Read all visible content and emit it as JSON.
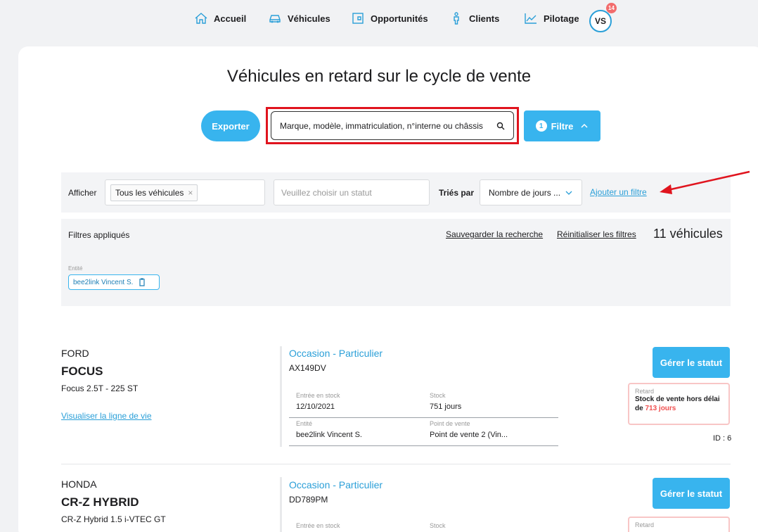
{
  "nav": {
    "items": [
      {
        "label": "Accueil",
        "icon": "home-icon"
      },
      {
        "label": "Véhicules",
        "icon": "car-icon"
      },
      {
        "label": "Opportunités",
        "icon": "wallet-icon"
      },
      {
        "label": "Clients",
        "icon": "person-icon"
      },
      {
        "label": "Pilotage",
        "icon": "chart-icon"
      }
    ],
    "avatar": "VS",
    "badge": "14"
  },
  "page": {
    "title": "Véhicules en retard sur le cycle de vente"
  },
  "toolbar": {
    "export_label": "Exporter",
    "search_placeholder": "Marque, modèle, immatriculation, n°interne ou châssis",
    "filter_count": "1",
    "filter_label": "Filtre"
  },
  "filters": {
    "show_label": "Afficher",
    "show_chip": "Tous les véhicules",
    "status_placeholder": "Veuillez choisir un statut",
    "sort_label": "Triés par",
    "sort_value": "Nombre de jours ...",
    "add_filter": "Ajouter un filtre"
  },
  "applied": {
    "title": "Filtres appliqués",
    "save_search": "Sauvegarder la recherche",
    "reset": "Réinitialiser les filtres",
    "count": "11 véhicules",
    "entity_label": "Entité",
    "entity_value": "bee2link Vincent S."
  },
  "vehicles": [
    {
      "brand": "FORD",
      "model": "FOCUS",
      "version": "Focus 2.5T - 225 ST",
      "lifeline": "Visualiser la ligne de vie",
      "type": "Occasion - Particulier",
      "plate": "AX149DV",
      "stock_entry_label": "Entrée en stock",
      "stock_entry": "12/10/2021",
      "stock_label": "Stock",
      "stock": "751 jours",
      "entity_label": "Entité",
      "entity": "bee2link Vincent S.",
      "pos_label": "Point de vente",
      "pos": "Point de vente 2 (Vin...",
      "status_button": "Gérer le statut",
      "delay_label": "Retard",
      "delay_text": "Stock de vente hors délai",
      "delay_prefix": "de",
      "delay_days": "713 jours",
      "id": "ID : 6"
    },
    {
      "brand": "HONDA",
      "model": "CR-Z HYBRID",
      "version": "CR-Z Hybrid 1.5 i-VTEC GT",
      "type": "Occasion - Particulier",
      "plate": "DD789PM",
      "stock_entry_label": "Entrée en stock",
      "stock_label": "Stock",
      "status_button": "Gérer le statut",
      "delay_label": "Retard"
    }
  ],
  "colors": {
    "accent": "#38b4ee",
    "link": "#2a9fd8",
    "highlight_red": "#e0141e",
    "delay_red": "#f05050"
  }
}
